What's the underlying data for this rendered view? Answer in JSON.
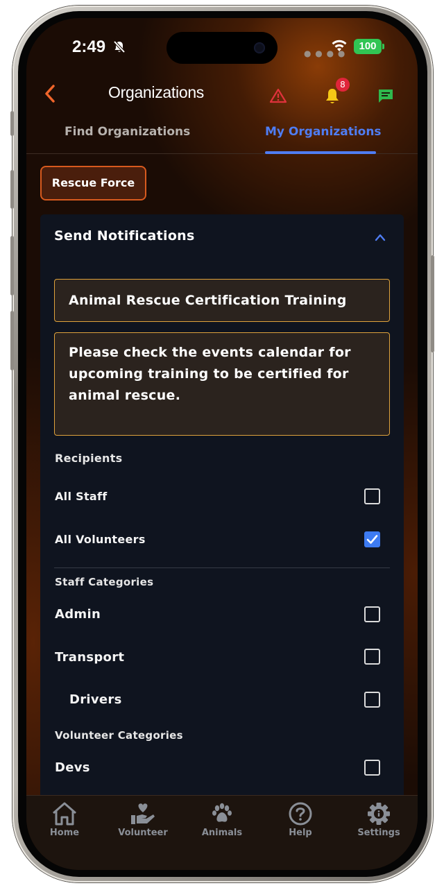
{
  "status_bar": {
    "time": "2:49",
    "battery": "100"
  },
  "header": {
    "title": "Organizations",
    "notification_count": "8",
    "colors": {
      "back": "#f0652a",
      "alert": "#e0323c",
      "bell": "#f5c816",
      "chat": "#2fb84d"
    }
  },
  "tabs": [
    {
      "label": "Find Organizations",
      "active": false
    },
    {
      "label": "My Organizations",
      "active": true
    }
  ],
  "org_chip": {
    "label": "Rescue Force"
  },
  "notification_panel": {
    "title": "Send Notifications",
    "subject": "Animal Rescue Certification Training",
    "message": "Please check the events calendar for upcoming training to be certified for animal rescue.",
    "recipients": {
      "heading": "Recipients",
      "items": [
        {
          "label": "All Staff",
          "checked": false
        },
        {
          "label": "All Volunteers",
          "checked": true
        }
      ]
    },
    "staff_categories": {
      "heading": "Staff Categories",
      "items": [
        {
          "label": "Admin",
          "checked": false
        },
        {
          "label": "Transport",
          "checked": false
        },
        {
          "label": "Drivers",
          "checked": false
        }
      ]
    },
    "volunteer_categories": {
      "heading": "Volunteer Categories",
      "items": [
        {
          "label": "Devs",
          "checked": false
        }
      ]
    }
  },
  "bottom_nav": [
    {
      "label": "Home",
      "icon": "home-icon"
    },
    {
      "label": "Volunteer",
      "icon": "volunteer-hand-heart-icon"
    },
    {
      "label": "Animals",
      "icon": "paw-icon"
    },
    {
      "label": "Help",
      "icon": "help-question-icon"
    },
    {
      "label": "Settings",
      "icon": "gear-icon"
    }
  ]
}
